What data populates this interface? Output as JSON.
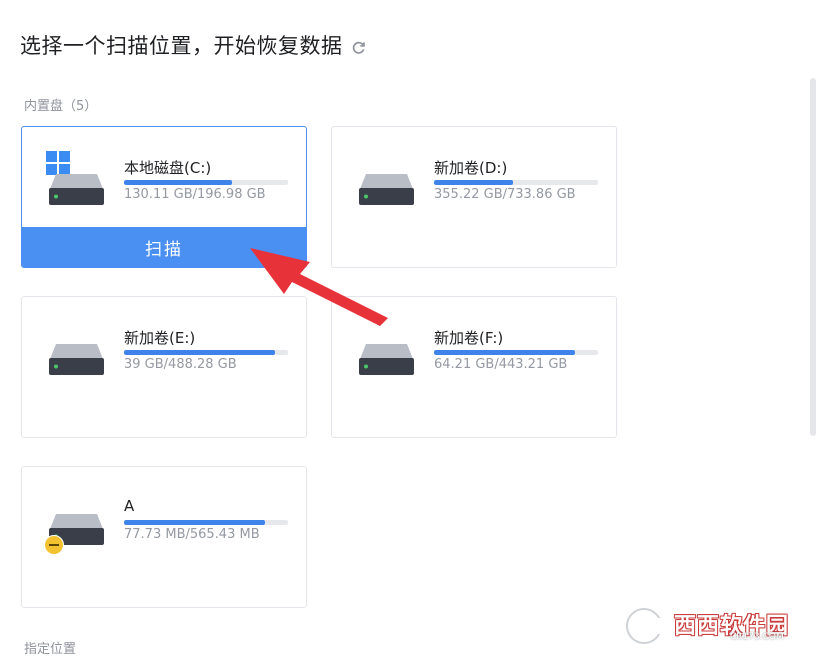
{
  "header": {
    "title": "选择一个扫描位置，开始恢复数据"
  },
  "sections": {
    "internal_label": "内置盘（5）",
    "location_label": "指定位置"
  },
  "drives": [
    {
      "name": "本地磁盘(C:)",
      "size": "130.11 GB/196.98 GB",
      "used_fraction": 0.66,
      "selected": true,
      "scan_label": "扫描",
      "icon": "windows-icon"
    },
    {
      "name": "新加卷(D:)",
      "size": "355.22 GB/733.86 GB",
      "used_fraction": 0.48
    },
    {
      "name": "新加卷(E:)",
      "size": "39 GB/488.28 GB",
      "used_fraction": 0.92
    },
    {
      "name": "新加卷(F:)",
      "size": "64.21 GB/443.21 GB",
      "used_fraction": 0.86
    },
    {
      "name": "A",
      "size": "77.73 MB/565.43 MB",
      "used_fraction": 0.86,
      "icon": "warning-icon"
    }
  ],
  "watermark": {
    "text": "西西软件园",
    "sub": "CR173.COM"
  },
  "colors": {
    "accent": "#4a8ff2",
    "bar_fill": "#3d83ea",
    "arrow": "#e8323a"
  }
}
